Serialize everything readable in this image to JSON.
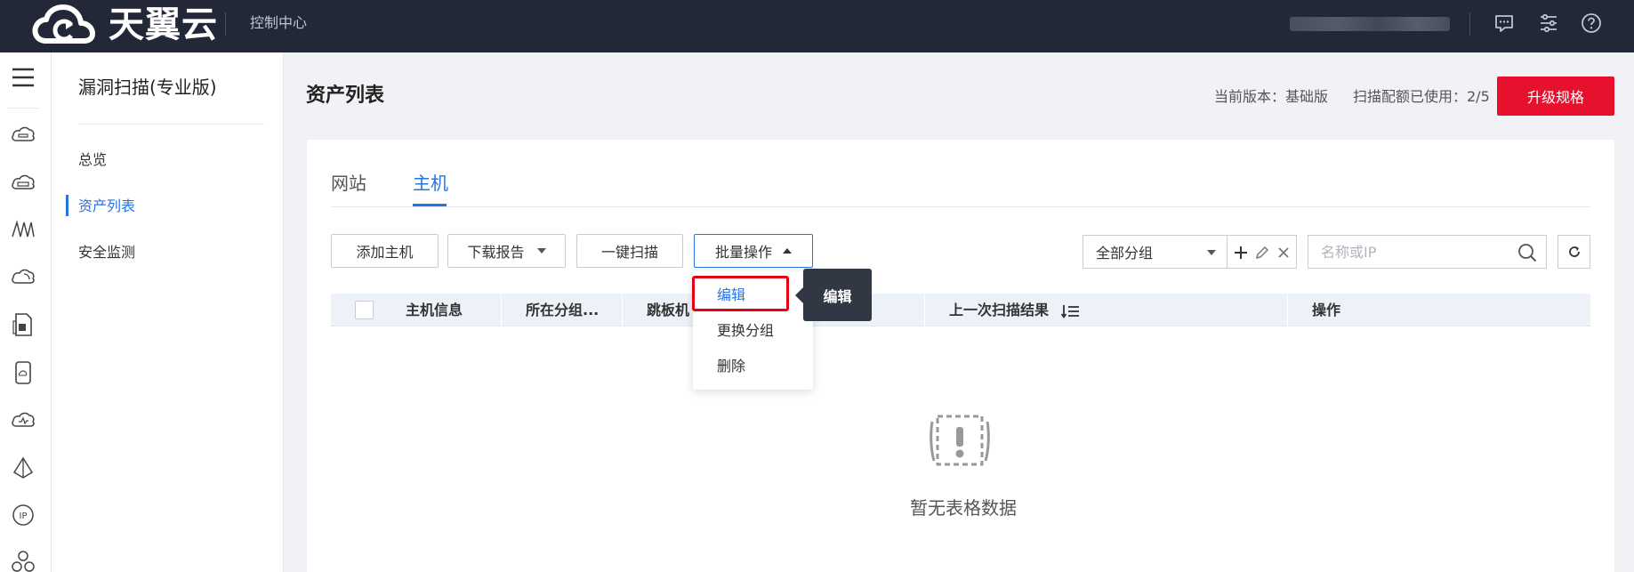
{
  "topbar": {
    "brand": "天翼云",
    "console_link": "控制中心",
    "icons": [
      "message-icon",
      "settings-sliders-icon",
      "help-icon"
    ]
  },
  "rail": {
    "icons": [
      "menu-icon",
      "cloud-server-icon",
      "cloud-host-icon",
      "network-icon",
      "cloud-icon",
      "document-icon",
      "phone-cloud-icon",
      "cloud-monitor-icon",
      "prism-icon",
      "ip-icon",
      "cluster-icon"
    ]
  },
  "subnav": {
    "title": "漏洞扫描(专业版)",
    "items": [
      {
        "label": "总览",
        "active": false
      },
      {
        "label": "资产列表",
        "active": true
      },
      {
        "label": "安全监测",
        "active": false
      }
    ]
  },
  "header": {
    "title": "资产列表",
    "version_text": "当前版本：基础版",
    "quota_text": "扫描配额已使用：2/5",
    "upgrade_label": "升级规格",
    "accent": "#e8112d"
  },
  "tabs": [
    {
      "label": "网站",
      "active": false
    },
    {
      "label": "主机",
      "active": true
    }
  ],
  "toolbar": {
    "add_host": "添加主机",
    "download_report": "下载报告",
    "one_click_scan": "一键扫描",
    "batch_ops": "批量操作",
    "group_select": "全部分组",
    "search_placeholder": "名称或IP"
  },
  "table": {
    "columns": [
      "主机信息",
      "所在分组...",
      "跳板机",
      "上一次扫描结果",
      "操作"
    ],
    "empty_text": "暂无表格数据"
  },
  "batch_menu": {
    "items": [
      "编辑",
      "更换分组",
      "删除"
    ],
    "tooltip": "编辑"
  },
  "colors": {
    "primary": "#2673e6",
    "topbar": "#232838",
    "highlight": "#e60012"
  }
}
